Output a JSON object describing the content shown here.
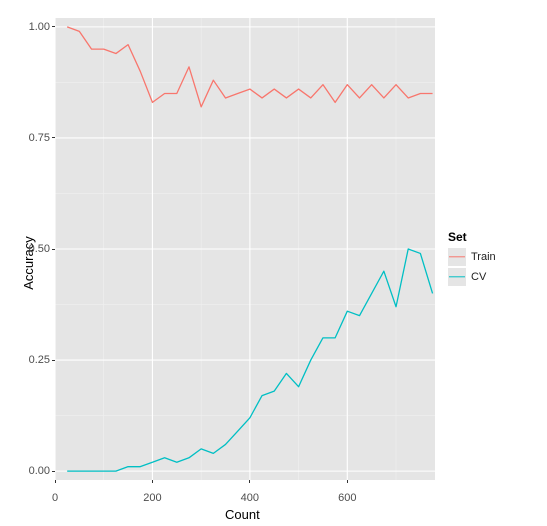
{
  "chart_data": {
    "type": "line",
    "title": "",
    "xlabel": "Count",
    "ylabel": "Accuracy",
    "xlim": [
      0,
      780
    ],
    "ylim": [
      -0.02,
      1.02
    ],
    "x_ticks": [
      0,
      200,
      400,
      600
    ],
    "y_ticks": [
      0.0,
      0.25,
      0.5,
      0.75,
      1.0
    ],
    "y_tick_labels": [
      "0.00",
      "0.25",
      "0.50",
      "0.75",
      "1.00"
    ],
    "legend_title": "Set",
    "legend_position": "right",
    "grid": true,
    "series": [
      {
        "name": "Train",
        "color": "#F8766D",
        "x": [
          25,
          50,
          75,
          100,
          125,
          150,
          175,
          200,
          225,
          250,
          275,
          300,
          325,
          350,
          375,
          400,
          425,
          450,
          475,
          500,
          525,
          550,
          575,
          600,
          625,
          650,
          675,
          700,
          725,
          750,
          775
        ],
        "y": [
          1.0,
          0.99,
          0.95,
          0.95,
          0.94,
          0.96,
          0.9,
          0.83,
          0.85,
          0.85,
          0.91,
          0.82,
          0.88,
          0.84,
          0.85,
          0.86,
          0.84,
          0.86,
          0.84,
          0.86,
          0.84,
          0.87,
          0.83,
          0.87,
          0.84,
          0.87,
          0.84,
          0.87,
          0.84,
          0.85,
          0.85
        ]
      },
      {
        "name": "CV",
        "color": "#00BFC4",
        "x": [
          25,
          50,
          75,
          100,
          125,
          150,
          175,
          200,
          225,
          250,
          275,
          300,
          325,
          350,
          375,
          400,
          425,
          450,
          475,
          500,
          525,
          550,
          575,
          600,
          625,
          650,
          675,
          700,
          725,
          750,
          775
        ],
        "y": [
          0.0,
          0.0,
          0.0,
          0.0,
          0.0,
          0.01,
          0.01,
          0.02,
          0.03,
          0.02,
          0.03,
          0.05,
          0.04,
          0.06,
          0.09,
          0.12,
          0.17,
          0.18,
          0.22,
          0.19,
          0.25,
          0.3,
          0.3,
          0.36,
          0.35,
          0.4,
          0.45,
          0.37,
          0.5,
          0.49,
          0.4
        ]
      }
    ]
  }
}
